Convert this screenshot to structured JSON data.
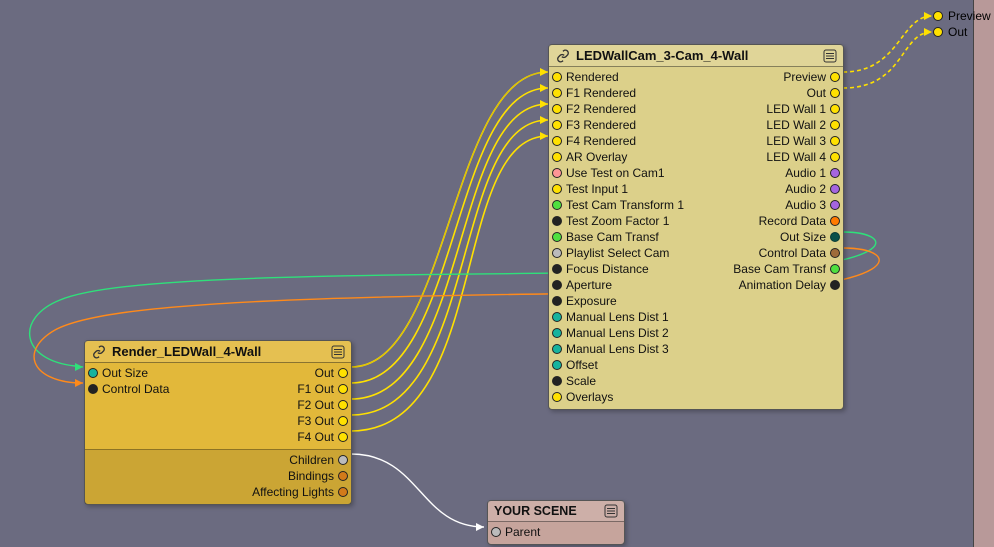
{
  "nodes": {
    "left": {
      "title": "Render_LEDWall_4-Wall",
      "inputs": [
        {
          "label": "Out Size",
          "color": "c-teal"
        },
        {
          "label": "Control Data",
          "color": "c-black"
        }
      ],
      "outputs": [
        {
          "label": "Out",
          "color": "c-yellow"
        },
        {
          "label": "F1 Out",
          "color": "c-yellow"
        },
        {
          "label": "F2 Out",
          "color": "c-yellow"
        },
        {
          "label": "F3 Out",
          "color": "c-yellow"
        },
        {
          "label": "F4 Out",
          "color": "c-yellow"
        }
      ],
      "footer_outputs": [
        {
          "label": "Children",
          "color": "c-gray"
        },
        {
          "label": "Bindings",
          "color": "c-orangeD"
        },
        {
          "label": "Affecting Lights",
          "color": "c-orangeD"
        }
      ]
    },
    "right": {
      "title": "LEDWallCam_3-Cam_4-Wall",
      "inputs": [
        {
          "label": "Rendered",
          "color": "c-yellow"
        },
        {
          "label": "F1 Rendered",
          "color": "c-yellow"
        },
        {
          "label": "F2 Rendered",
          "color": "c-yellow"
        },
        {
          "label": "F3 Rendered",
          "color": "c-yellow"
        },
        {
          "label": "F4 Rendered",
          "color": "c-yellow"
        },
        {
          "label": "AR Overlay",
          "color": "c-yellow"
        },
        {
          "label": "Use Test on Cam1",
          "color": "c-pink"
        },
        {
          "label": "Test Input 1",
          "color": "c-yellow"
        },
        {
          "label": "Test Cam Transform 1",
          "color": "c-green"
        },
        {
          "label": "Test Zoom Factor 1",
          "color": "c-black"
        },
        {
          "label": "Base Cam Transf",
          "color": "c-green"
        },
        {
          "label": "Playlist Select Cam",
          "color": "c-gray"
        },
        {
          "label": "Focus Distance",
          "color": "c-black"
        },
        {
          "label": "Aperture",
          "color": "c-black"
        },
        {
          "label": "Exposure",
          "color": "c-black"
        },
        {
          "label": "Manual Lens Dist 1",
          "color": "c-teal"
        },
        {
          "label": "Manual Lens Dist 2",
          "color": "c-teal"
        },
        {
          "label": "Manual Lens Dist 3",
          "color": "c-teal"
        },
        {
          "label": "Offset",
          "color": "c-teal"
        },
        {
          "label": "Scale",
          "color": "c-black"
        },
        {
          "label": "Overlays",
          "color": "c-yellow"
        }
      ],
      "outputs": [
        {
          "label": "Preview",
          "color": "c-yellow"
        },
        {
          "label": "Out",
          "color": "c-yellow"
        },
        {
          "label": "LED Wall 1",
          "color": "c-yellow"
        },
        {
          "label": "LED Wall 2",
          "color": "c-yellow"
        },
        {
          "label": "LED Wall 3",
          "color": "c-yellow"
        },
        {
          "label": "LED Wall 4",
          "color": "c-yellow"
        },
        {
          "label": "Audio 1",
          "color": "c-purple"
        },
        {
          "label": "Audio 2",
          "color": "c-purple"
        },
        {
          "label": "Audio 3",
          "color": "c-purple"
        },
        {
          "label": "Record Data",
          "color": "c-orange"
        },
        {
          "label": "Out Size",
          "color": "c-darkteal"
        },
        {
          "label": "Control Data",
          "color": "c-brown"
        },
        {
          "label": "Base Cam Transf",
          "color": "c-green"
        },
        {
          "label": "Animation Delay",
          "color": "c-black"
        }
      ]
    },
    "scene": {
      "title": "YOUR SCENE",
      "inputs": [
        {
          "label": "Parent",
          "color": "c-gray"
        }
      ]
    }
  },
  "outlets": {
    "preview": "Preview",
    "out": "Out"
  }
}
